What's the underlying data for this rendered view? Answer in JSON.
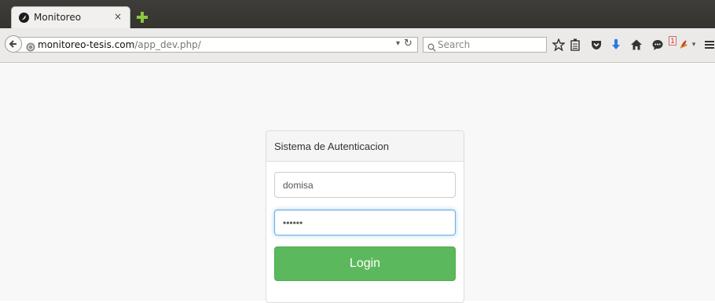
{
  "browser": {
    "tab": {
      "title": "Monitoreo",
      "close_glyph": "×"
    },
    "url": {
      "host": "monitoreo-tesis.com",
      "path": "/app_dev.php/"
    },
    "search": {
      "placeholder": "Search"
    },
    "notification_count": "1",
    "toolbar_icons": [
      "bookmark-star-icon",
      "reading-list-icon",
      "pocket-icon",
      "download-icon",
      "home-icon",
      "chat-icon",
      "extension-icon",
      "menu-icon"
    ]
  },
  "login": {
    "panel_title": "Sistema de Autenticacion",
    "username": "domisa",
    "password": "••••••",
    "submit_label": "Login"
  },
  "colors": {
    "login_green": "#5cb85c",
    "focus_blue": "#66afe9",
    "page_bg": "#f8f8f8"
  }
}
